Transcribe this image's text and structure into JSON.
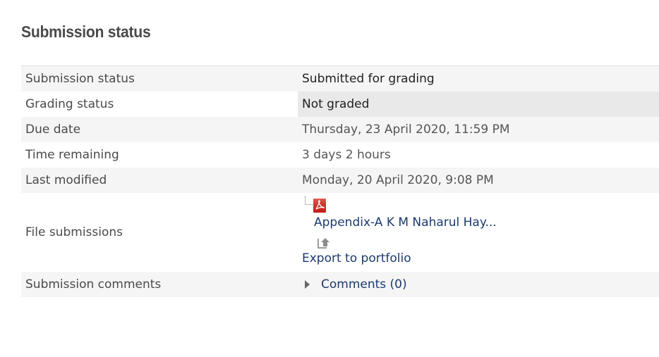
{
  "heading": "Submission status",
  "rows": {
    "submission_status": {
      "label": "Submission status",
      "value": "Submitted for grading"
    },
    "grading_status": {
      "label": "Grading status",
      "value": "Not graded"
    },
    "due_date": {
      "label": "Due date",
      "value": "Thursday, 23 April 2020, 11:59 PM"
    },
    "time_remaining": {
      "label": "Time remaining",
      "value": "3 days 2 hours"
    },
    "last_modified": {
      "label": "Last modified",
      "value": "Monday, 20 April 2020, 9:08 PM"
    },
    "file_submissions": {
      "label": "File submissions",
      "file_name": "Appendix-A K M Naharul Hay...",
      "file_icon": "pdf-icon",
      "export_label": "Export to portfolio",
      "export_icon": "portfolio-export-icon"
    },
    "submission_comments": {
      "label": "Submission comments",
      "link": "Comments (0)",
      "icon": "caret-right-icon"
    }
  },
  "colors": {
    "row_stripe": "#f5f5f5",
    "not_graded_bg": "#e9e9e9",
    "link": "#1a3a6e",
    "pdf_red": "#d9261c"
  }
}
